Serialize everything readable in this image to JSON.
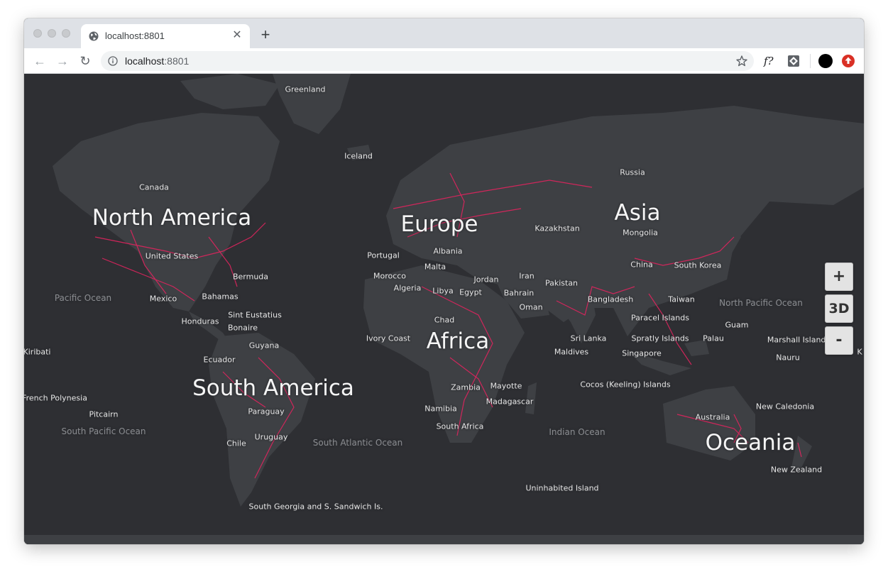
{
  "browser": {
    "tab_title": "localhost:8801",
    "url_host": "localhost",
    "url_port": ":8801",
    "icons": [
      "globe-icon",
      "close-icon",
      "plus-icon",
      "back-icon",
      "forward-icon",
      "reload-icon",
      "info-icon",
      "star-icon",
      "fx-extension-icon",
      "extension-icon",
      "profile-icon",
      "update-icon"
    ],
    "extension_text": "f?",
    "accent_update": "#d93025"
  },
  "map": {
    "background": "#2e2f33",
    "land_color": "#3e4044",
    "road_color": "#e0245e",
    "continents": [
      "North America",
      "Europe",
      "Asia",
      "Africa",
      "South America",
      "Oceania"
    ],
    "oceans": [
      "Pacific Ocean",
      "North Pacific Ocean",
      "South Pacific Ocean",
      "South Atlantic Ocean",
      "Indian Ocean"
    ],
    "places": [
      "Greenland",
      "Iceland",
      "Russia",
      "Canada",
      "Kazakhstan",
      "Mongolia",
      "United States",
      "Portugal",
      "Albania",
      "Malta",
      "Morocco",
      "Algeria",
      "Libya",
      "Egypt",
      "Jordan",
      "Iran",
      "Bahrain",
      "Pakistan",
      "Oman",
      "China",
      "South Korea",
      "Bermuda",
      "Mexico",
      "Bahamas",
      "Sint Eustatius",
      "Honduras",
      "Bonaire",
      "Bangladesh",
      "Taiwan",
      "Paracel Islands",
      "Guam",
      "Chad",
      "Ivory Coast",
      "Sri Lanka",
      "Spratly Islands",
      "Palau",
      "Marshall Islands",
      "Maldives",
      "Singapore",
      "Nauru",
      "Kiribati",
      "Guyana",
      "Ecuador",
      "Zambia",
      "Mayotte",
      "Madagascar",
      "Cocos (Keeling) Islands",
      "French Polynesia",
      "Namibia",
      "New Caledonia",
      "Paraguay",
      "Pitcairn",
      "Australia",
      "South Africa",
      "Uruguay",
      "Chile",
      "New Zealand",
      "Uninhabited Island",
      "South Georgia and S. Sandwich Is.",
      "K"
    ]
  },
  "controls": {
    "zoom_in": "+",
    "toggle_3d": "3D",
    "zoom_out": "-"
  }
}
